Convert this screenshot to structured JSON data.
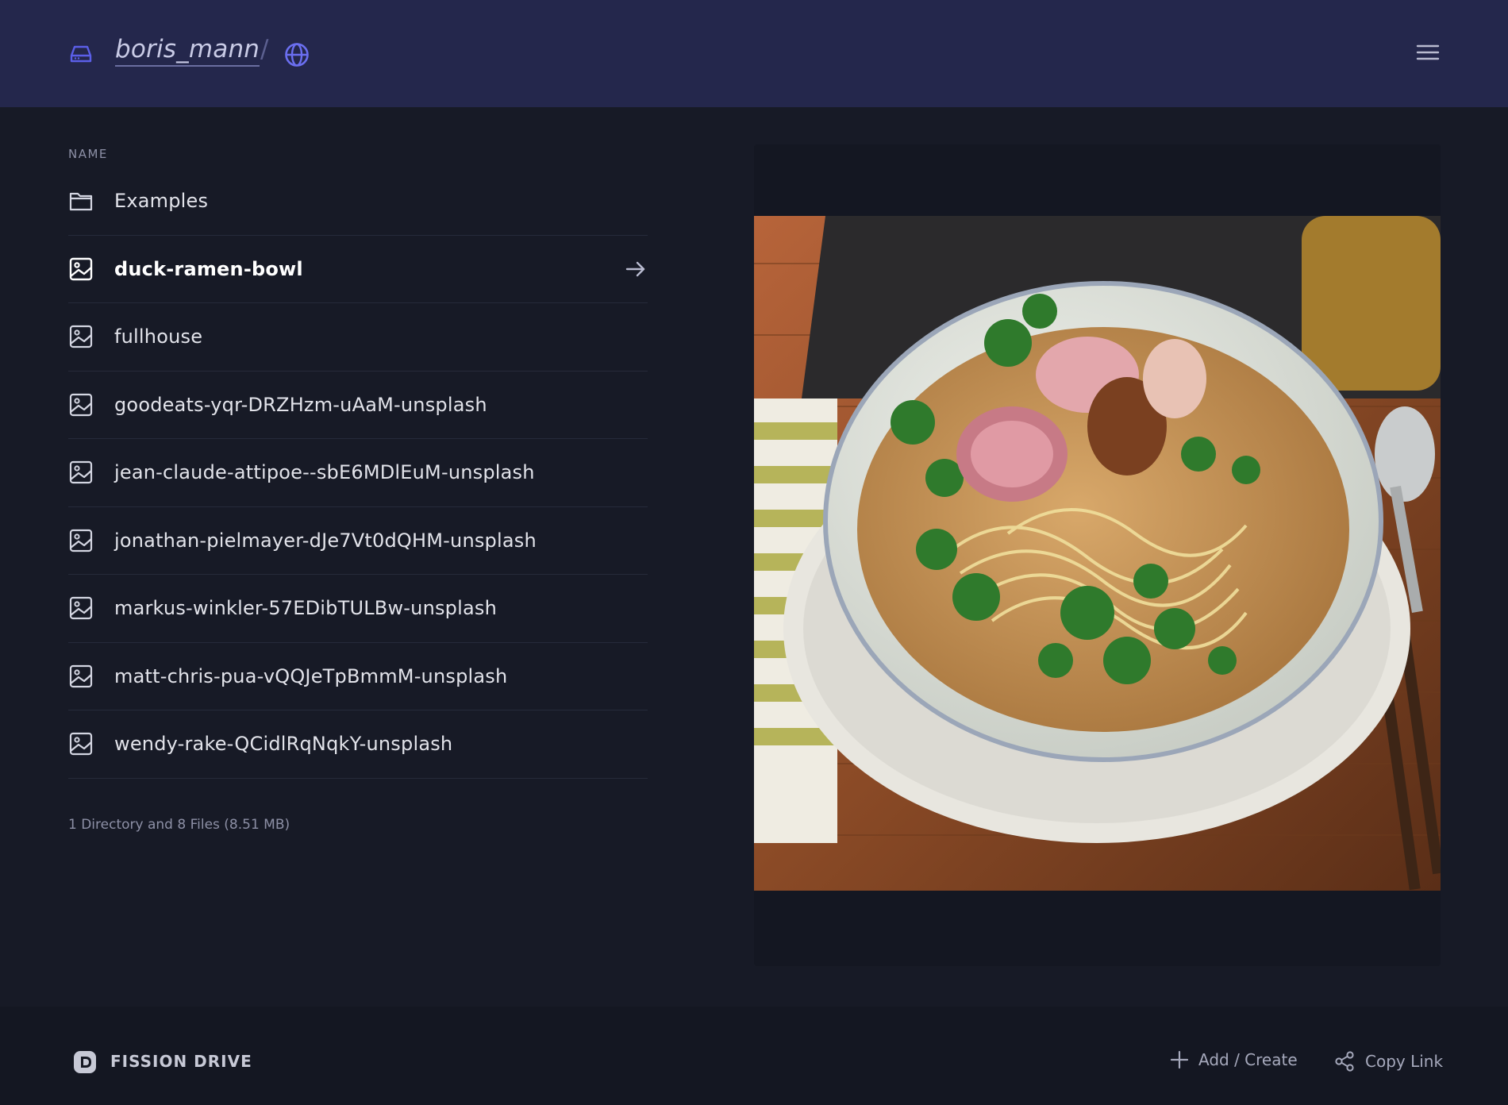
{
  "header": {
    "drive_icon": "hard-drive-icon",
    "username": "boris_mann",
    "separator": "/",
    "public_icon": "globe-icon",
    "menu_icon": "hamburger-menu-icon",
    "background_color": "#24274c"
  },
  "listing": {
    "column_header": "NAME",
    "items": [
      {
        "name": "Examples",
        "icon": "folder-icon"
      },
      {
        "name": "duck-ramen-bowl",
        "icon": "image-file-icon",
        "selected": true
      },
      {
        "name": "fullhouse",
        "icon": "image-file-icon"
      },
      {
        "name": "goodeats-yqr-DRZHzm-uAaM-unsplash",
        "icon": "image-file-icon"
      },
      {
        "name": "jean-claude-attipoe--sbE6MDlEuM-unsplash",
        "icon": "image-file-icon"
      },
      {
        "name": "jonathan-pielmayer-dJe7Vt0dQHM-unsplash",
        "icon": "image-file-icon"
      },
      {
        "name": "markus-winkler-57EDibTULBw-unsplash",
        "icon": "image-file-icon"
      },
      {
        "name": "matt-chris-pua-vQQJeTpBmmM-unsplash",
        "icon": "image-file-icon"
      },
      {
        "name": "wendy-rake-QCidlRqNqkY-unsplash",
        "icon": "image-file-icon"
      }
    ],
    "summary": "1 Directory and 8 Files (8.51 MB)"
  },
  "preview": {
    "image_subject": "duck ramen bowl photo"
  },
  "footer": {
    "brand_icon": "fission-logo-icon",
    "brand_name": "FISSION DRIVE",
    "add_label": "Add / Create",
    "add_icon": "plus-icon",
    "copy_label": "Copy Link",
    "copy_icon": "share-icon"
  },
  "colors": {
    "accent": "#5b5fe8",
    "background": "#171a26"
  }
}
